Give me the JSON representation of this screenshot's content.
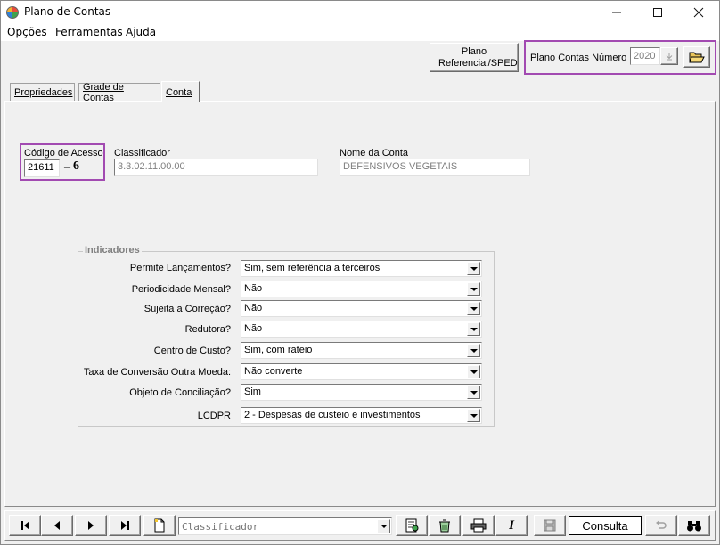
{
  "window": {
    "title": "Plano de Contas"
  },
  "menu": [
    {
      "label": "Opções"
    },
    {
      "label": "Ferramentas"
    },
    {
      "label": "Ajuda"
    }
  ],
  "toolbar": {
    "plano_referencial_label": "Plano Referencial/SPED",
    "plano_contas_numero_label": "Plano Contas Número",
    "plano_contas_numero_value": "2020"
  },
  "tabs": [
    {
      "label": "Propriedades"
    },
    {
      "label": "Grade de Contas"
    },
    {
      "label": "Conta"
    }
  ],
  "account": {
    "codigo_label": "Código de Acesso",
    "codigo_value": "21611",
    "codigo_digit": "6",
    "classificador_label": "Classificador",
    "classificador_value": "3.3.02.11.00.00",
    "nome_label": "Nome da Conta",
    "nome_value": "DEFENSIVOS VEGETAIS"
  },
  "indicadores": {
    "title": "Indicadores",
    "rows": [
      {
        "label": "Permite Lançamentos?",
        "value": "Sim, sem referência a terceiros"
      },
      {
        "label": "Periodicidade Mensal?",
        "value": "Não"
      },
      {
        "label": "Sujeita a Correção?",
        "value": "Não"
      },
      {
        "label": "Redutora?",
        "value": "Não"
      },
      {
        "label": "Centro de Custo?",
        "value": "Sim, com rateio"
      },
      {
        "label": "Taxa de Conversão Outra Moeda:",
        "value": "Não converte"
      },
      {
        "label": "Objeto de Conciliação?",
        "value": "Sim"
      },
      {
        "label": "LCDPR",
        "value": "2 - Despesas de custeio e investimentos"
      }
    ]
  },
  "statusbar": {
    "search_placeholder": "Classificador",
    "mode": "Consulta"
  },
  "colors": {
    "highlight": "#a24ab1"
  }
}
